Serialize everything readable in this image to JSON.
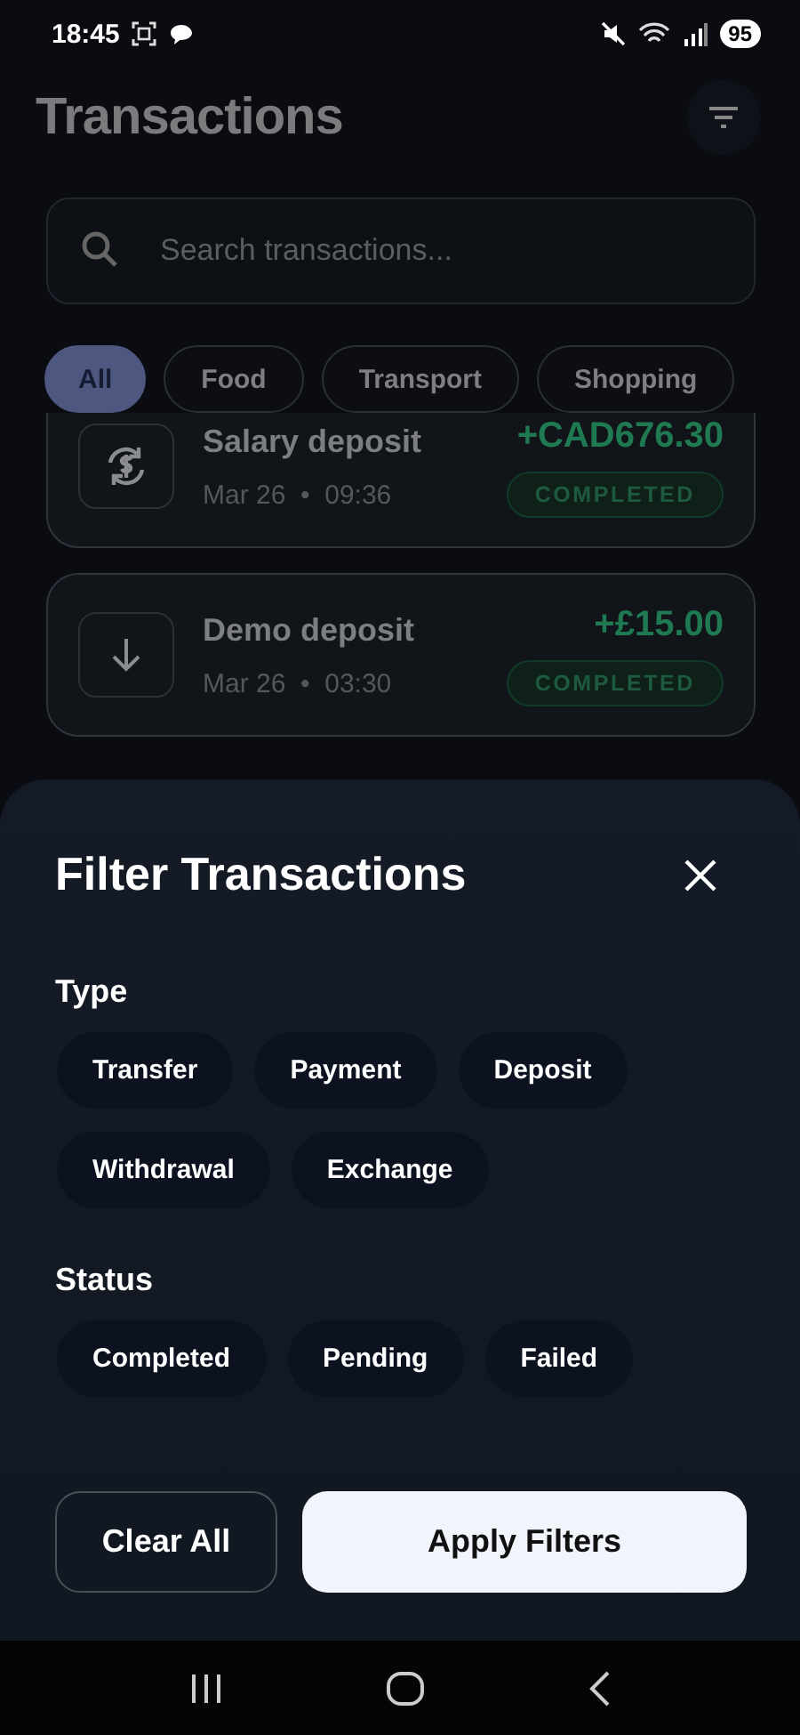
{
  "status_bar": {
    "time": "18:45",
    "battery": "95"
  },
  "header": {
    "title": "Transactions"
  },
  "search": {
    "placeholder": "Search transactions..."
  },
  "categories": [
    {
      "label": "All",
      "selected": true
    },
    {
      "label": "Food",
      "selected": false
    },
    {
      "label": "Transport",
      "selected": false
    },
    {
      "label": "Shopping",
      "selected": false
    }
  ],
  "transactions": [
    {
      "kind": "exchange",
      "title": "Salary deposit",
      "meta": "Mar 26  •  09:36",
      "amount": "+CAD676.30",
      "status": "COMPLETED"
    },
    {
      "kind": "deposit",
      "title": "Demo deposit",
      "meta": "Mar 26  •  03:30",
      "amount": "+£15.00",
      "status": "COMPLETED"
    }
  ],
  "filter_sheet": {
    "title": "Filter Transactions",
    "sections": [
      {
        "title": "Type",
        "options": [
          {
            "label": "Transfer",
            "selected": false
          },
          {
            "label": "Payment",
            "selected": false
          },
          {
            "label": "Deposit",
            "selected": false
          },
          {
            "label": "Withdrawal",
            "selected": false
          },
          {
            "label": "Exchange",
            "selected": false
          }
        ]
      },
      {
        "title": "Status",
        "options": [
          {
            "label": "Completed",
            "selected": false
          },
          {
            "label": "Pending",
            "selected": false
          },
          {
            "label": "Failed",
            "selected": false
          }
        ]
      }
    ],
    "buttons": [
      {
        "kind": "secondary",
        "label": "Clear All"
      },
      {
        "kind": "primary",
        "label": "Apply Filters"
      }
    ]
  }
}
